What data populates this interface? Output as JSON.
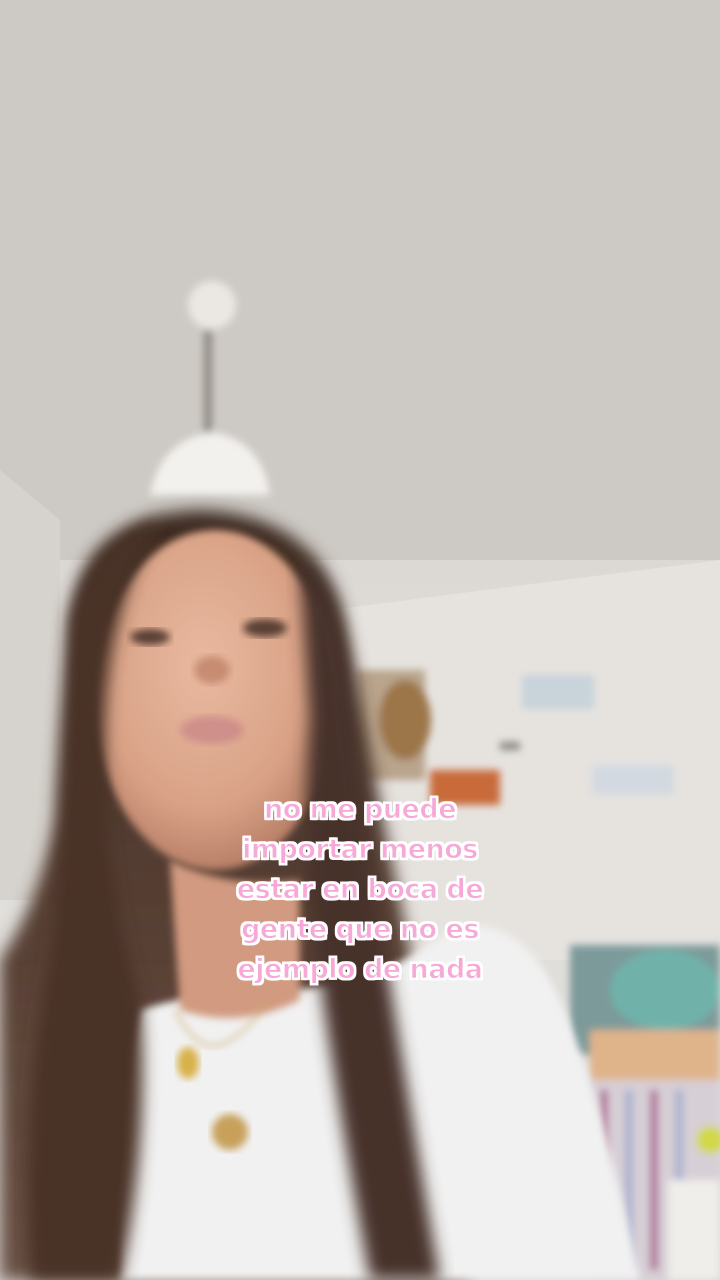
{
  "caption": {
    "line1": "no me puede",
    "line2": "importar menos",
    "line3": "estar en boca de",
    "line4": "gente que no es",
    "line5": "ejemplo de nada"
  },
  "colors": {
    "caption_fill": "#f6a8d6",
    "caption_outline": "#ffffff"
  }
}
